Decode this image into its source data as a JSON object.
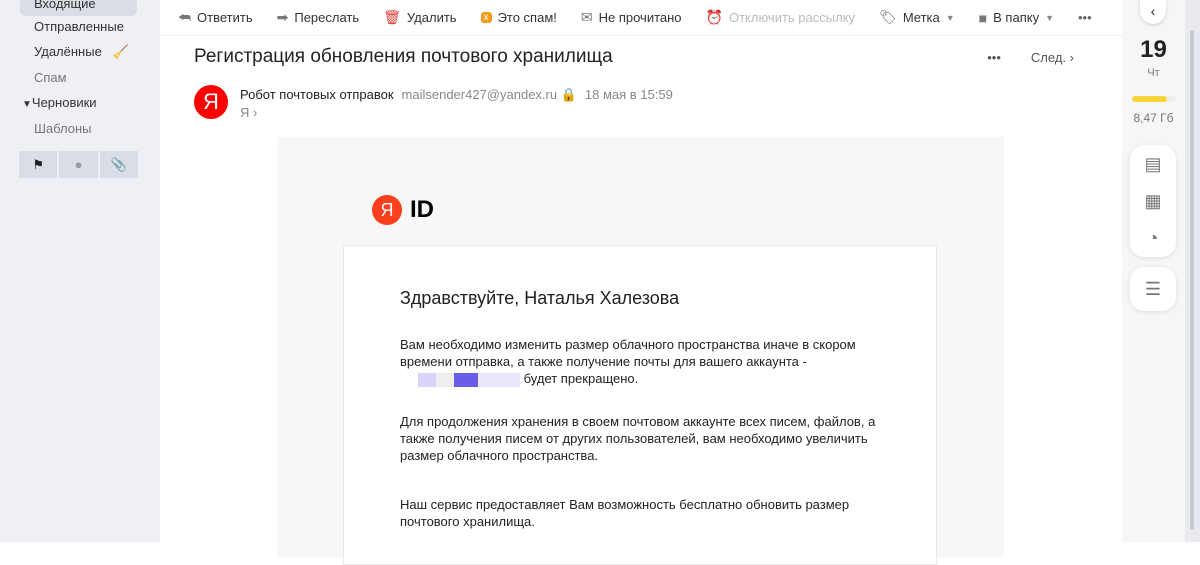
{
  "sidebar": {
    "folders": [
      "Входящие",
      "Отправленные",
      "Удалённые",
      "Спам",
      "Черновики",
      "Шаблоны"
    ]
  },
  "toolbar": {
    "reply": "Ответить",
    "forward": "Переслать",
    "delete": "Удалить",
    "spam": "Это спам!",
    "unread": "Не прочитано",
    "unsubscribe": "Отключить рассылку",
    "label": "Метка",
    "folder": "В папку"
  },
  "message": {
    "subject": "Регистрация обновления почтового хранилища",
    "next": "След.",
    "sender_name": "Робот почтовых отправок",
    "sender_email": "mailsender427@yandex.ru",
    "date": "18 мая в 15:59",
    "to": "Я",
    "avatar_letter": "Я"
  },
  "body": {
    "logo_letter": "Я",
    "logo_text": "ID",
    "greeting": "Здравствуйте, Наталья Халезова",
    "p1": "Вам необходимо изменить размер облачного пространства иначе в скором времени отправка, а также получение почты для вашего аккаунта -",
    "p1_end": "будет прекращено.",
    "p2": "Для продолжения хранения в своем почтовом аккаунте всех писем, файлов, а также получения писем от других пользователей, вам необходимо увеличить размер облачного пространства.",
    "p3": "Наш сервис предоставляет Вам возможность бесплатно обновить размер почтового хранилища."
  },
  "right": {
    "day": "19",
    "weekday": "Чт",
    "storage": "8,47 Гб",
    "storage_fill_percent": 80
  }
}
